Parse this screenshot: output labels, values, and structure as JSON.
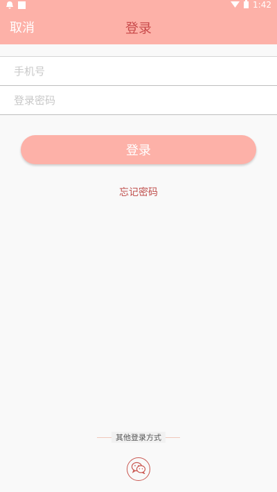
{
  "status_bar": {
    "time": "1:42"
  },
  "app_bar": {
    "cancel_label": "取消",
    "title": "登录"
  },
  "form": {
    "phone": {
      "placeholder": "手机号",
      "value": ""
    },
    "password": {
      "placeholder": "登录密码",
      "value": ""
    }
  },
  "actions": {
    "login_label": "登录",
    "forgot_label": "忘记密码"
  },
  "footer": {
    "other_login_label": "其他登录方式",
    "wechat_icon": "wechat-icon"
  },
  "colors": {
    "accent": "#fdb1a8",
    "title_red": "#c94b4b",
    "link_red": "#c0504d"
  }
}
